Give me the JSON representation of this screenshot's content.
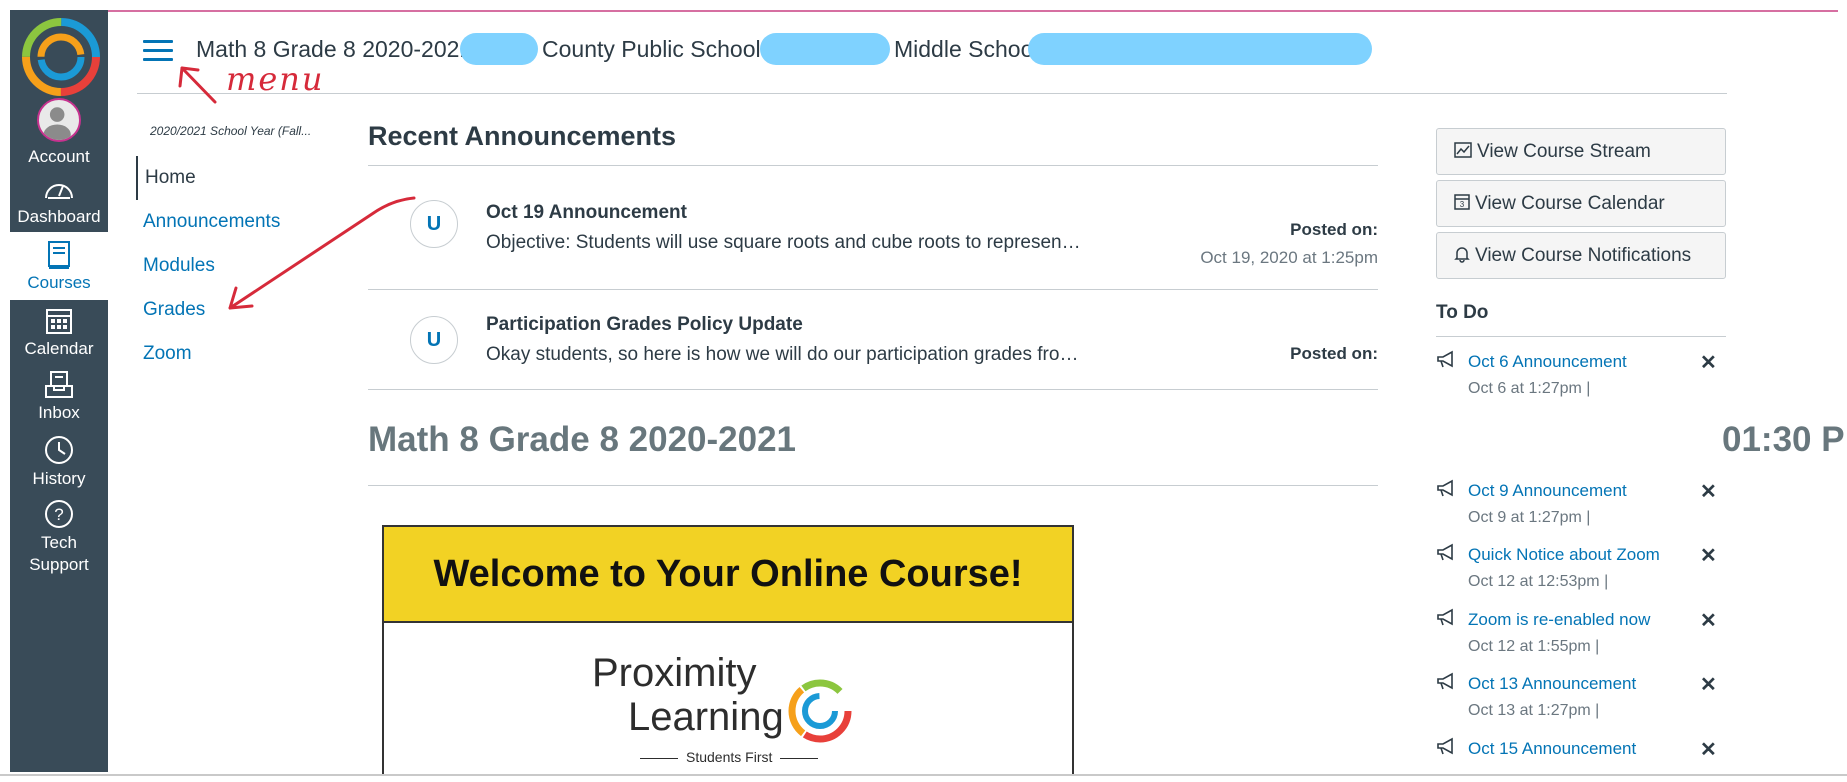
{
  "global_nav": {
    "items": [
      {
        "label": "Account",
        "icon": "account-avatar"
      },
      {
        "label": "Dashboard",
        "icon": "dashboard-icon"
      },
      {
        "label": "Courses",
        "icon": "courses-icon",
        "active": true
      },
      {
        "label": "Calendar",
        "icon": "calendar-icon"
      },
      {
        "label": "Inbox",
        "icon": "inbox-icon"
      },
      {
        "label": "History",
        "icon": "history-icon"
      },
      {
        "label": "Tech Support",
        "line1": "Tech",
        "line2": "Support",
        "icon": "help-icon"
      }
    ],
    "colors": {
      "background": "#394b58",
      "active": "#0374b5"
    }
  },
  "header": {
    "crumb_part1": "Math 8 Grade 8 2020-2021",
    "crumb_part2": "County Public Schools-",
    "crumb_part3": "Middle School"
  },
  "annotations": {
    "menu_label": "menu"
  },
  "course_nav": {
    "term": "2020/2021 School Year (Fall...",
    "items": [
      "Home",
      "Announcements",
      "Modules",
      "Grades",
      "Zoom"
    ]
  },
  "main": {
    "recent_heading": "Recent Announcements",
    "announcements": [
      {
        "avatar": "U",
        "title": "Oct 19 Announcement",
        "body": "Objective: Students will use square roots and cube roots to represen…",
        "posted_label": "Posted on:",
        "posted_date": "Oct 19, 2020 at 1:25pm"
      },
      {
        "avatar": "U",
        "title": "Participation Grades Policy Update",
        "body": "Okay students, so here is how we will do our participation grades fro…",
        "posted_label": "Posted on:",
        "posted_date": ""
      }
    ],
    "course_heading": "Math 8 Grade 8 2020-2021",
    "course_heading_tail": "01:30 P",
    "welcome_banner": "Welcome to Your Online Course!",
    "logo_word1": "Proximity",
    "logo_word2": "Learning",
    "logo_tagline": "Students First"
  },
  "sidebar": {
    "buttons": [
      {
        "label": "View Course Stream",
        "icon": "stream-icon"
      },
      {
        "label": "View Course Calendar",
        "icon": "calendar-icon"
      },
      {
        "label": "View Course Notifications",
        "icon": "bell-icon"
      }
    ],
    "todo_heading": "To Do",
    "todo_items": [
      {
        "title": "Oct 6 Announcement",
        "meta": "Oct 6 at 1:27pm  |"
      },
      {
        "title": "",
        "meta": ""
      },
      {
        "title": "Oct 9 Announcement",
        "meta": "Oct 9 at 1:27pm  |"
      },
      {
        "title": "Quick Notice about Zoom",
        "meta": "Oct 12 at 12:53pm  |"
      },
      {
        "title": "Zoom is re-enabled now",
        "meta": "Oct 12 at 1:55pm  |"
      },
      {
        "title": "Oct 13 Announcement",
        "meta": "Oct 13 at 1:27pm  |"
      },
      {
        "title": "Oct 15 Announcement",
        "meta": ""
      }
    ],
    "dismiss_glyph": "✕"
  }
}
